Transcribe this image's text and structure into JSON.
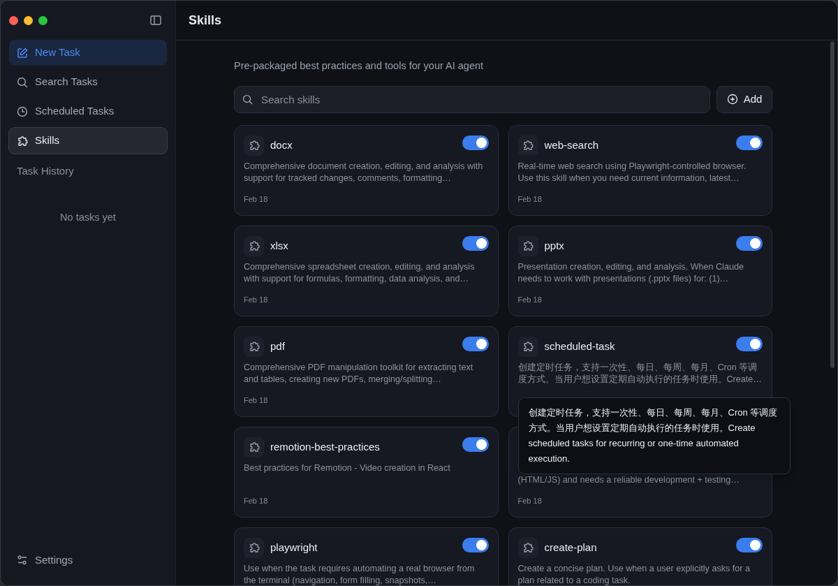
{
  "sidebar": {
    "items": [
      {
        "label": "New Task",
        "kind": "new",
        "selected": false
      },
      {
        "label": "Search Tasks",
        "kind": "search",
        "selected": false
      },
      {
        "label": "Scheduled Tasks",
        "kind": "clock",
        "selected": false
      },
      {
        "label": "Skills",
        "kind": "puzzle",
        "selected": true
      }
    ],
    "history_title": "Task History",
    "empty_text": "No tasks yet",
    "settings": "Settings"
  },
  "page": {
    "title": "Skills",
    "subtitle": "Pre-packaged best practices and tools for your AI agent",
    "search": {
      "placeholder": "Search skills"
    },
    "add_button": "Add"
  },
  "skills": [
    {
      "name": "docx",
      "on": true,
      "description": "Comprehensive document creation, editing, and analysis with support for tracked changes, comments, formatting…",
      "date": "Feb 18"
    },
    {
      "name": "web-search",
      "on": true,
      "description": "Real-time web search using Playwright-controlled browser. Use this skill when you need current information, latest…",
      "date": "Feb 18"
    },
    {
      "name": "xlsx",
      "on": true,
      "description": "Comprehensive spreadsheet creation, editing, and analysis with support for formulas, formatting, data analysis, and…",
      "date": "Feb 18"
    },
    {
      "name": "pptx",
      "on": true,
      "description": "Presentation creation, editing, and analysis. When Claude needs to work with presentations (.pptx files) for: (1)…",
      "date": "Feb 18"
    },
    {
      "name": "pdf",
      "on": true,
      "description": "Comprehensive PDF manipulation toolkit for extracting text and tables, creating new PDFs, merging/splitting…",
      "date": "Feb 18"
    },
    {
      "name": "scheduled-task",
      "on": true,
      "description": "创建定时任务，支持一次性、每日、每周、每月、Cron 等调度方式。当用户想设置定期自动执行的任务时使用。Create…",
      "tooltip": "创建定时任务，支持一次性、每日、每周、每月、Cron 等调度方式。当用户想设置定期自动执行的任务时使用。Create scheduled tasks for recurring or one-time automated execution."
    },
    {
      "name": "remotion-best-practices",
      "on": true,
      "description": "Best practices for Remotion - Video creation in React",
      "date": "Feb 18"
    },
    {
      "description": "(HTML/JS) and needs a reliable development + testing…",
      "date": "Feb 18"
    },
    {
      "name": "playwright",
      "on": true,
      "description": "Use when the task requires automating a real browser from the terminal (navigation, form filling, snapshots,…"
    },
    {
      "name": "create-plan",
      "on": true,
      "description": "Create a concise plan. Use when a user explicitly asks for a plan related to a coding task."
    }
  ]
}
